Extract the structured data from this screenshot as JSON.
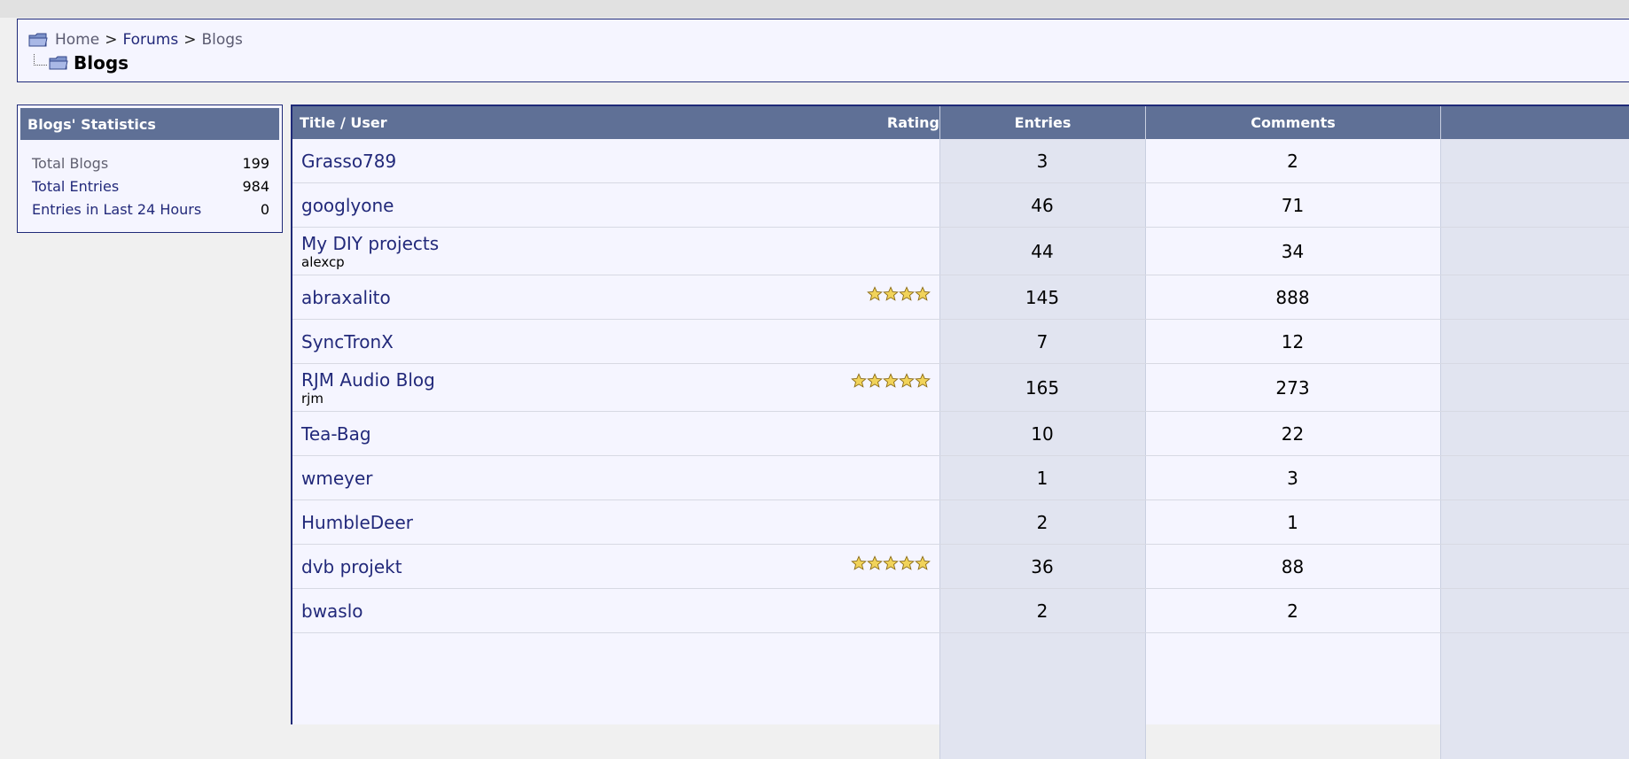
{
  "breadcrumb": {
    "home": "Home",
    "forums": "Forums",
    "current": "Blogs",
    "separator": ">"
  },
  "page_title": "Blogs",
  "stats": {
    "header": "Blogs' Statistics",
    "total_blogs_label": "Total Blogs",
    "total_blogs_value": "199",
    "total_entries_label": "Total Entries",
    "total_entries_value": "984",
    "last24_label": "Entries in Last 24 Hours",
    "last24_value": "0"
  },
  "table": {
    "headers": {
      "title_user": "Title / User",
      "rating": "Rating",
      "entries": "Entries",
      "comments": "Comments"
    },
    "rows": [
      {
        "title": "Grasso789",
        "user": "",
        "entries": "3",
        "comments": "2",
        "rating_stars": 0
      },
      {
        "title": "googlyone",
        "user": "",
        "entries": "46",
        "comments": "71",
        "rating_stars": 0
      },
      {
        "title": "My DIY projects",
        "user": "alexcp",
        "entries": "44",
        "comments": "34",
        "rating_stars": 0
      },
      {
        "title": "abraxalito",
        "user": "",
        "entries": "145",
        "comments": "888",
        "rating_stars": 4
      },
      {
        "title": "SyncTronX",
        "user": "",
        "entries": "7",
        "comments": "12",
        "rating_stars": 0
      },
      {
        "title": "RJM Audio Blog",
        "user": "rjm",
        "entries": "165",
        "comments": "273",
        "rating_stars": 5
      },
      {
        "title": "Tea-Bag",
        "user": "",
        "entries": "10",
        "comments": "22",
        "rating_stars": 0
      },
      {
        "title": "wmeyer",
        "user": "",
        "entries": "1",
        "comments": "3",
        "rating_stars": 0
      },
      {
        "title": "HumbleDeer",
        "user": "",
        "entries": "2",
        "comments": "1",
        "rating_stars": 0
      },
      {
        "title": "dvb projekt",
        "user": "",
        "entries": "36",
        "comments": "88",
        "rating_stars": 5
      },
      {
        "title": "bwaslo",
        "user": "",
        "entries": "2",
        "comments": "2",
        "rating_stars": 0
      }
    ]
  },
  "colors": {
    "header_bg": "#5f7096",
    "link": "#22297a",
    "border": "#1f2a78",
    "alt_col": "#e1e4f0"
  },
  "icons": {
    "folder": "folder-icon",
    "star": "star-icon"
  }
}
